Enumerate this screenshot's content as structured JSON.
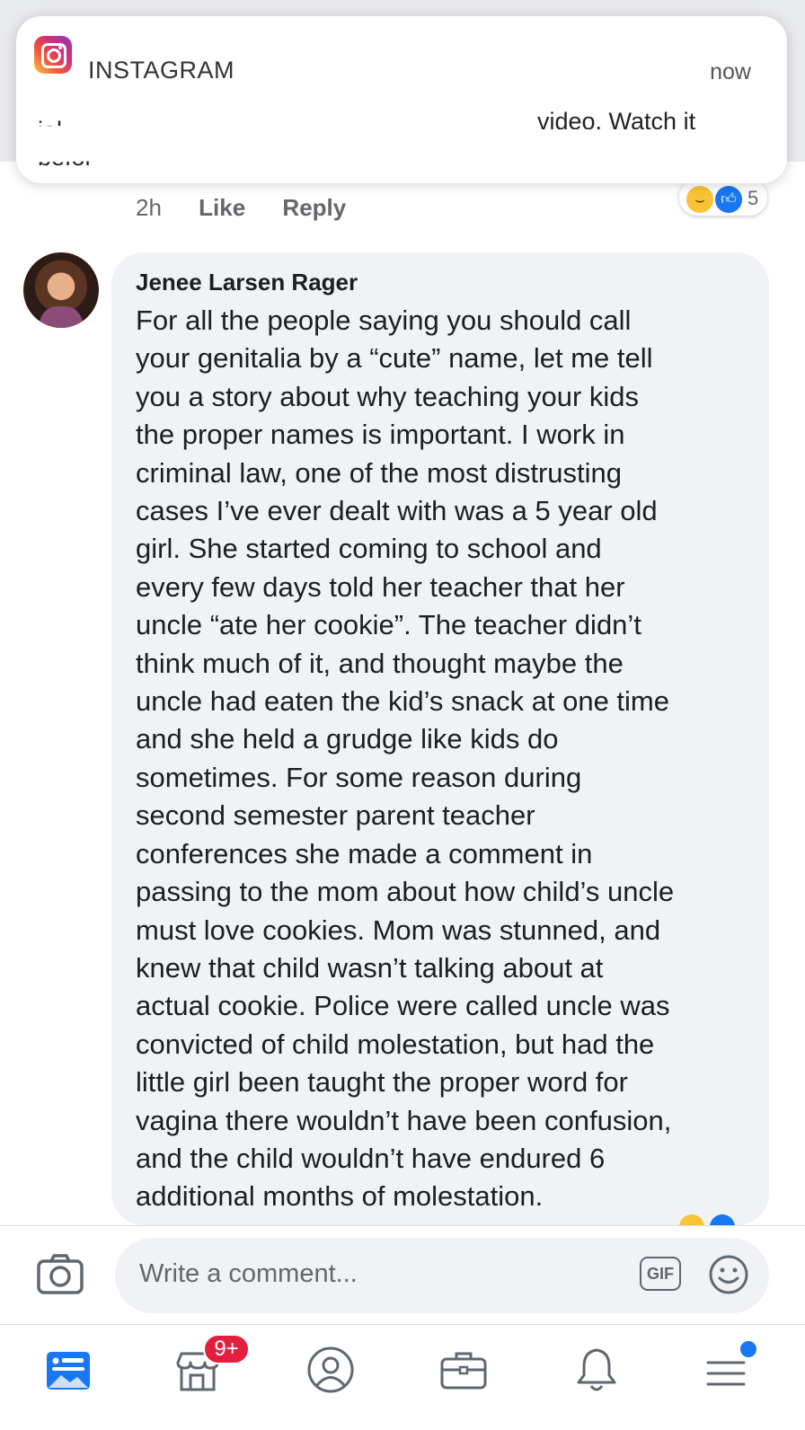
{
  "notification": {
    "app_name": "INSTAGRAM",
    "time": "now",
    "body_line1_left": "ial.",
    "body_line1_right": "video. Watch it",
    "body_line2": "befor"
  },
  "previous_comment": {
    "time": "2h",
    "like_label": "Like",
    "reply_label": "Reply",
    "reaction_count": "5",
    "reactions": [
      "haha-icon",
      "like-icon"
    ]
  },
  "comment": {
    "author": "Jenee Larsen Rager",
    "lines": [
      "For all the people saying you should call",
      "your genitalia by a “cute” name, let me tell",
      "you a story about why teaching your kids",
      "the proper names is important.   I work in",
      "criminal law, one of the most distrusting",
      "cases I’ve ever dealt with was a 5 year old",
      "girl.   She started coming to school and",
      "every few days told her teacher that her",
      "uncle “ate her cookie”.   The teacher didn’t",
      "think much of it, and thought maybe the",
      "uncle had eaten the kid’s snack at one time",
      "and she held a grudge like kids do",
      "sometimes.   For some reason during",
      "second semester parent teacher",
      "conferences she made a comment in",
      "passing to the mom about how child’s uncle",
      "must love cookies.   Mom was stunned, and",
      "knew that child wasn’t talking about at",
      "actual cookie.   Police were called uncle was",
      "convicted of child molestation, but had the",
      "little girl been taught the proper word for",
      "vagina there wouldn’t have been confusion,",
      "and the child wouldn’t have endured 6",
      "additional months of molestation."
    ]
  },
  "composer": {
    "placeholder": "Write a comment...",
    "gif_label": "GIF"
  },
  "tabbar": {
    "items": [
      "news-feed-icon",
      "marketplace-icon",
      "profile-icon",
      "jobs-icon",
      "notifications-icon",
      "menu-icon"
    ],
    "marketplace_badge": "9+",
    "accent": "#1877f2",
    "badge_color": "#e41e3f"
  }
}
